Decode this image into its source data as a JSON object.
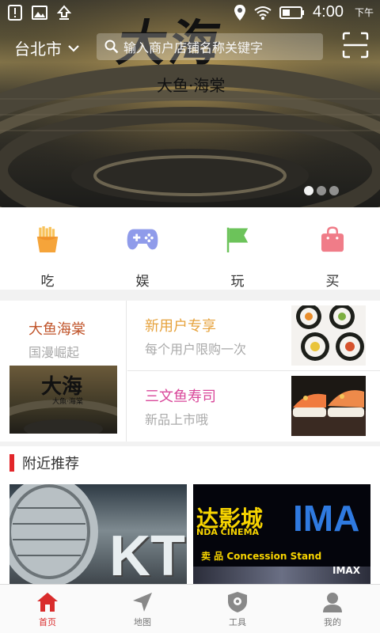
{
  "status_bar": {
    "time": "4:00",
    "ampm": "下午"
  },
  "banner": {
    "calligraphy": "大海",
    "subtitle": "大鱼·海棠",
    "slides": [
      {
        "active": true
      },
      {
        "active": false
      },
      {
        "active": false
      }
    ]
  },
  "header": {
    "city": "台北市",
    "search_placeholder": "输入商户店铺名称关键字"
  },
  "categories": [
    {
      "label": "吃",
      "icon": "fries-icon",
      "color": "#f5a43a"
    },
    {
      "label": "娱",
      "icon": "gamepad-icon",
      "color": "#8f9bea"
    },
    {
      "label": "玩",
      "icon": "flag-icon",
      "color": "#6cc35a"
    },
    {
      "label": "买",
      "icon": "shopping-bag-icon",
      "color": "#f07c88"
    }
  ],
  "promo": {
    "featured": {
      "title": "大鱼海棠",
      "subtitle": "国漫崛起",
      "image_text": "大海",
      "image_sub": "大魚·海棠"
    },
    "items": [
      {
        "title": "新用户专享",
        "subtitle": "每个用户限购一次",
        "title_color": "#e6a23c"
      },
      {
        "title": "三文鱼寿司",
        "subtitle": "新品上市哦",
        "title_color": "#d9479a"
      }
    ]
  },
  "nearby": {
    "title": "附近推荐",
    "cards": [
      {
        "label": "KT"
      },
      {
        "headline": "达影城",
        "brand": "IMA",
        "sub": "NDA CINEMA",
        "sign": "卖 品 Concession Stand",
        "tag": "IMAX"
      }
    ]
  },
  "tabs": [
    {
      "label": "首页",
      "icon": "home-icon",
      "active": true
    },
    {
      "label": "地图",
      "icon": "navigation-arrow-icon",
      "active": false
    },
    {
      "label": "工具",
      "icon": "shield-icon",
      "active": false
    },
    {
      "label": "我的",
      "icon": "user-icon",
      "active": false
    }
  ],
  "colors": {
    "accent": "#d92c2c",
    "section_bar": "#e2262a"
  }
}
